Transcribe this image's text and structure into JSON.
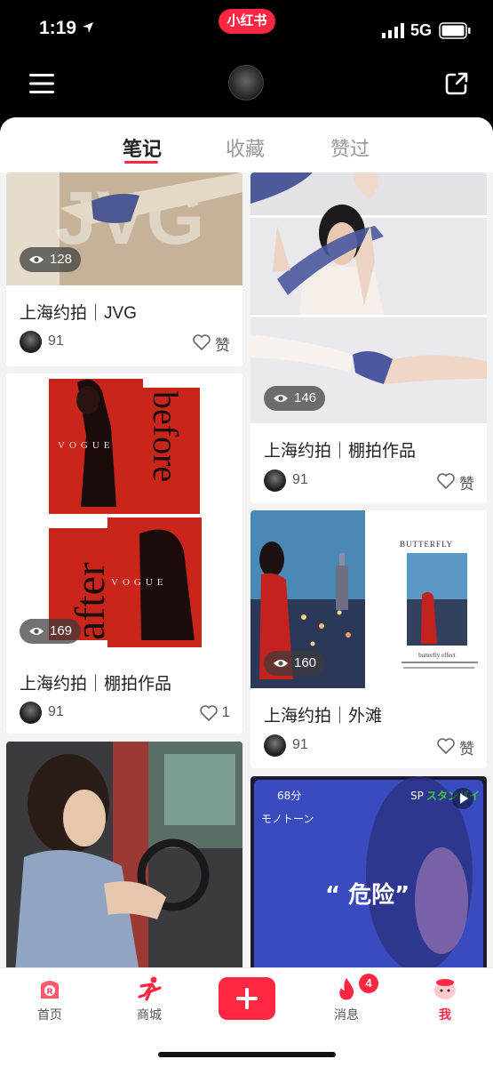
{
  "status_bar": {
    "time": "1:19",
    "app_pill": "小红书",
    "network": "5G"
  },
  "tabs": [
    {
      "label": "笔记",
      "active": true
    },
    {
      "label": "收藏",
      "active": false
    },
    {
      "label": "赞过",
      "active": false
    }
  ],
  "posts": [
    {
      "views": "128",
      "title": "上海约拍｜JVG",
      "author": "91",
      "likes": "赞"
    },
    {
      "views": "146",
      "title": "上海约拍｜棚拍作品",
      "author": "91",
      "likes": "赞"
    },
    {
      "views": "169",
      "title": "上海约拍｜棚拍作品",
      "author": "91",
      "likes": "1"
    },
    {
      "views": "160",
      "title": "上海约拍｜外滩",
      "author": "91",
      "likes": "赞"
    }
  ],
  "images": {
    "jvg_overlay": "JVG",
    "vogue": "VOGUE",
    "before": "before",
    "after": "after",
    "butterfly": "BUTTERFLY",
    "butterfly_effect": "butterfly effect",
    "video_top_left": "68分",
    "video_top_right": "スタンバイ",
    "video_sp": "SP",
    "video_subtitle": "モノトーン",
    "video_caption": "“ 危险”"
  },
  "bottom_nav": {
    "home": "首页",
    "mall": "商城",
    "messages": "消息",
    "messages_badge": "4",
    "me": "我"
  },
  "colors": {
    "accent": "#ff2741",
    "panel_bg": "#f3f3f3"
  }
}
